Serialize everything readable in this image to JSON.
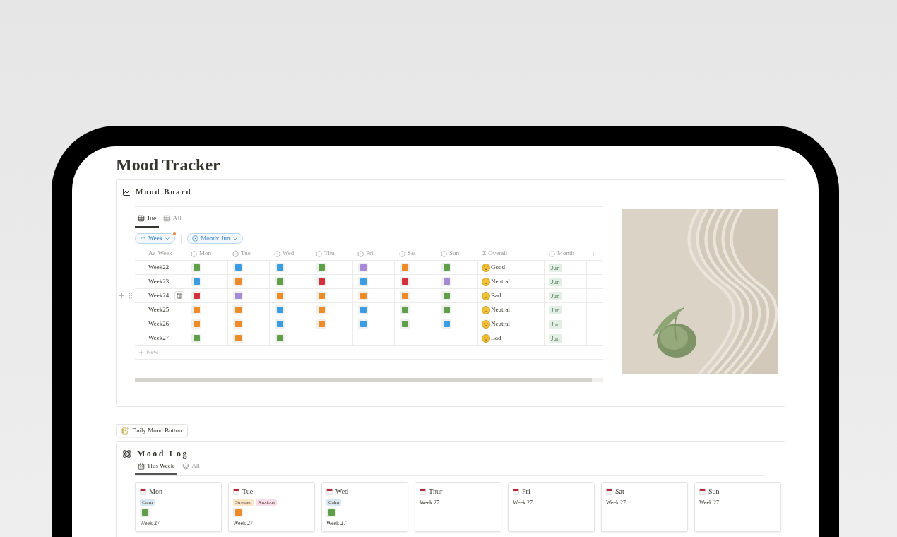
{
  "page": {
    "title": "Mood Tracker"
  },
  "mood_board": {
    "title": "Mood Board",
    "tabs": [
      {
        "label": "Jue",
        "selected": true
      },
      {
        "label": "All",
        "selected": false
      }
    ],
    "filters": [
      {
        "kind": "sort",
        "label": "Week",
        "modified": true
      },
      {
        "kind": "property",
        "label": "Month: Jun",
        "modified": false
      }
    ],
    "table": {
      "columns": [
        {
          "kind": "title",
          "icon_text": "Aa",
          "label": "Week"
        },
        {
          "kind": "select",
          "label": "Mon"
        },
        {
          "kind": "select",
          "label": "Tue"
        },
        {
          "kind": "select",
          "label": "Wed"
        },
        {
          "kind": "select",
          "label": "Thu"
        },
        {
          "kind": "select",
          "label": "Fri"
        },
        {
          "kind": "select",
          "label": "Sat"
        },
        {
          "kind": "select",
          "label": "Sun"
        },
        {
          "kind": "formula",
          "icon_text": "Σ",
          "label": "Overall"
        },
        {
          "kind": "select",
          "label": "Month"
        }
      ],
      "add_column": "+",
      "rows": [
        {
          "week": "Week22",
          "hovered": false,
          "days": [
            {
              "color": "#5f9f4a"
            },
            {
              "color": "#3a9de2"
            },
            {
              "color": "#3a9de2"
            },
            {
              "color": "#5f9f4a"
            },
            {
              "color": "#a68ad6"
            },
            {
              "color": "#ee8a28"
            },
            {
              "color": "#5f9f4a"
            }
          ],
          "overall": {
            "kind": "good",
            "label": "Good"
          },
          "month": "Jun"
        },
        {
          "week": "Week23",
          "hovered": false,
          "days": [
            {
              "color": "#3a9de2"
            },
            {
              "color": "#ee8a28"
            },
            {
              "color": "#5f9f4a"
            },
            {
              "color": "#d3303c"
            },
            {
              "color": "#3a9de2"
            },
            {
              "color": "#d3303c"
            },
            {
              "color": "#a68ad6"
            }
          ],
          "overall": {
            "kind": "neutral",
            "label": "Neutral"
          },
          "month": "Jun"
        },
        {
          "week": "Week24",
          "hovered": true,
          "days": [
            {
              "color": "#d3303c"
            },
            {
              "color": "#a68ad6"
            },
            {
              "color": "#ee8a28"
            },
            {
              "color": "#ee8a28"
            },
            {
              "color": "#ee8a28"
            },
            {
              "color": "#ee8a28"
            },
            {
              "color": "#5f9f4a"
            }
          ],
          "overall": {
            "kind": "bad",
            "label": "Bad"
          },
          "month": "Jun"
        },
        {
          "week": "Week25",
          "hovered": false,
          "days": [
            {
              "color": "#ee8a28"
            },
            {
              "color": "#ee8a28"
            },
            {
              "color": "#3a9de2"
            },
            {
              "color": "#ee8a28"
            },
            {
              "color": "#3a9de2"
            },
            {
              "color": "#5f9f4a"
            },
            {
              "color": "#5f9f4a"
            }
          ],
          "overall": {
            "kind": "neutral",
            "label": "Neutral"
          },
          "month": "Jun"
        },
        {
          "week": "Week26",
          "hovered": false,
          "days": [
            {
              "color": "#ee8a28"
            },
            {
              "color": "#ee8a28"
            },
            {
              "color": "#3a9de2"
            },
            {
              "color": "#ee8a28"
            },
            {
              "color": "#3a9de2"
            },
            {
              "color": "#5f9f4a"
            },
            {
              "color": "#3a9de2"
            }
          ],
          "overall": {
            "kind": "neutral",
            "label": "Neutral"
          },
          "month": "Jun"
        },
        {
          "week": "Week27",
          "hovered": false,
          "days": [
            {
              "color": "#5f9f4a"
            },
            {
              "color": "#ee8a28"
            },
            {
              "color": "#5f9f4a"
            }
          ],
          "overall": {
            "kind": "bad",
            "label": "Bad"
          },
          "month": "Jun"
        }
      ],
      "new_row": "New"
    }
  },
  "button": {
    "label": "Daily Mood Button"
  },
  "mood_log": {
    "title": "Mood Log",
    "tabs": [
      {
        "label": "This Week",
        "selected": true
      },
      {
        "label": "All",
        "selected": false
      }
    ],
    "cards": [
      {
        "title": "Mon",
        "tags": [
          {
            "label": "Calm",
            "color": "#d6e8f2"
          }
        ],
        "mood": {
          "color": "#5f9f4a"
        },
        "week": "Week 27"
      },
      {
        "title": "Tue",
        "tags": [
          {
            "label": "Stressed",
            "color": "#fbe6c8"
          },
          {
            "label": "Anxious",
            "color": "#f7dcea"
          }
        ],
        "mood": {
          "color": "#ee8a28"
        },
        "week": "Week 27"
      },
      {
        "title": "Wed",
        "tags": [
          {
            "label": "Calm",
            "color": "#d6e8f2"
          }
        ],
        "mood": {
          "color": "#5f9f4a"
        },
        "week": "Week 27"
      },
      {
        "title": "Thur",
        "week": "Week 27"
      },
      {
        "title": "Fri",
        "week": "Week 27"
      },
      {
        "title": "Sat",
        "week": "Week 27"
      },
      {
        "title": "Sun",
        "week": "Week 27"
      }
    ]
  }
}
